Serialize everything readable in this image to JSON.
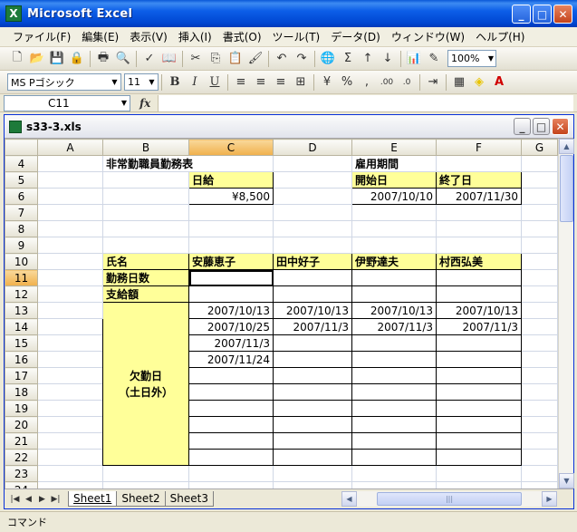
{
  "app": {
    "title": "Microsoft Excel",
    "icon_letter": "X"
  },
  "menu": [
    "ファイル(F)",
    "編集(E)",
    "表示(V)",
    "挿入(I)",
    "書式(O)",
    "ツール(T)",
    "データ(D)",
    "ウィンドウ(W)",
    "ヘルプ(H)"
  ],
  "toolbar": {
    "zoom": "100%",
    "font_name": "MS Pゴシック",
    "font_size": "11"
  },
  "formula_bar": {
    "name_box": "C11",
    "fx_label": "fx",
    "formula": ""
  },
  "workbook": {
    "title": "s33-3.xls"
  },
  "columns": [
    "A",
    "B",
    "C",
    "D",
    "E",
    "F"
  ],
  "cells": {
    "r4": {
      "B": "非常勤職員勤務表",
      "E": "雇用期間"
    },
    "r5": {
      "C": "日給",
      "E": "開始日",
      "F": "終了日"
    },
    "r6": {
      "C": "¥8,500",
      "E": "2007/10/10",
      "F": "2007/11/30"
    },
    "r10": {
      "B": "氏名",
      "C": "安藤恵子",
      "D": "田中好子",
      "E": "伊野達夫",
      "F": "村西弘美"
    },
    "r11": {
      "B": "勤務日数"
    },
    "r12": {
      "B": "支給額"
    },
    "r13": {
      "C": "2007/10/13",
      "D": "2007/10/13",
      "E": "2007/10/13",
      "F": "2007/10/13"
    },
    "r14": {
      "C": "2007/10/25",
      "D": "2007/11/3",
      "E": "2007/11/3",
      "F": "2007/11/3"
    },
    "r15": {
      "C": "2007/11/3"
    },
    "r16": {
      "C": "2007/11/24"
    },
    "absence_label_1": "欠勤日",
    "absence_label_2": "（土日外）"
  },
  "sheets": [
    "Sheet1",
    "Sheet2",
    "Sheet3"
  ],
  "status": {
    "mode": "コマンド"
  }
}
